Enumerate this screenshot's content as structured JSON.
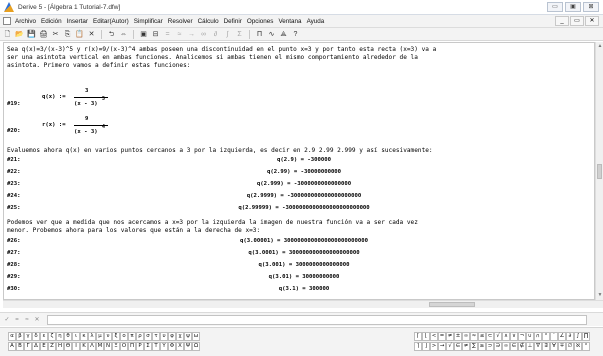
{
  "window": {
    "title": "Derive 5 - [Álgebra 1  Tutorial-7.dfw]",
    "buttons": [
      "▭",
      "▣",
      "⊠"
    ]
  },
  "menubar": {
    "items": [
      "Archivo",
      "Edición",
      "Insertar",
      "Editar(Autor)",
      "Simplificar",
      "Resolver",
      "Cálculo",
      "Definir",
      "Opciones",
      "Ventana",
      "Ayuda"
    ],
    "right_buttons": [
      "_",
      "▭",
      "✕"
    ]
  },
  "toolbar": {
    "icons": [
      "new-icon",
      "open-icon",
      "save-icon",
      "print-icon",
      "cut-icon",
      "copy-icon",
      "paste-icon",
      "delete-icon",
      "undo-icon",
      "renumber-icon",
      "author-icon",
      "solve-icon",
      "simplify-icon",
      "approximate-icon",
      "substitute-icon",
      "limit-icon",
      "derivative-icon",
      "integral-icon",
      "sum-icon",
      "product-icon",
      "plot2d-icon",
      "plot3d-icon",
      "help-icon"
    ],
    "glyphs": [
      "🗋",
      "📂",
      "💾",
      "🖨",
      "✂",
      "⎘",
      "📋",
      "✕",
      "⮌",
      "⇔",
      "▣",
      "⊟",
      "=",
      "≈",
      "→",
      "∞",
      "∂",
      "∫",
      "Σ",
      "Π",
      "∿",
      "⟁",
      "?"
    ]
  },
  "worksheet": {
    "intro": [
      "Sea q(x)=3/(x-3)^5 y r(x)=9/(x-3)^4 ambas poseen una discontinuidad en el punto x=3 y por tanto esta recta (x=3) va a",
      "ser una asintota vertical en ambas funciones. Analicemos si ambas tienen el mismo comportamiento alrededor de la",
      "asintota. Primero vamos a definir estas funciones:"
    ],
    "defs": [
      {
        "label": "#19:",
        "lhs": "q(x) :=",
        "num": "3",
        "den": "(x - 3)",
        "exp": "5"
      },
      {
        "label": "#20:",
        "lhs": "r(x) :=",
        "num": "9",
        "den": "(x - 3)",
        "exp": "4"
      }
    ],
    "text2": "Evaluemos ahora q(x) en varios puntos cercanos a 3 por la izquierda, es decir en 2.9 2.99 2.999 y así sucesivamente:",
    "left_evals": [
      {
        "label": "#21:",
        "expr": "q(2.9) = -300000"
      },
      {
        "label": "#22:",
        "expr": "q(2.99) = -30000000000"
      },
      {
        "label": "#23:",
        "expr": "q(2.999) = -3000000000000000"
      },
      {
        "label": "#24:",
        "expr": "q(2.9999) = -300000000000000000000"
      },
      {
        "label": "#25:",
        "expr": "q(2.99999) = -3000000000000000000000000"
      }
    ],
    "text3": [
      "Podemos ver que a medida que nos acercamos a x=3 por la izquierda la imagen de nuestra función va a ser cada vez",
      "menor. Probemos ahora para los valores que están a la derecha de x=3:"
    ],
    "right_evals": [
      {
        "label": "#26:",
        "expr": "q(3.00001) = 3000000000000000000000000"
      },
      {
        "label": "#27:",
        "expr": "q(3.0001) = 300000000000000000000"
      },
      {
        "label": "#28:",
        "expr": "q(3.001) = 3000000000000000"
      },
      {
        "label": "#29:",
        "expr": "q(3.01) = 30000000000"
      },
      {
        "label": "#30:",
        "expr": "q(3.1) = 300000"
      }
    ]
  },
  "entrybar": {
    "icons": [
      "✓",
      "=",
      "≈",
      "✕"
    ],
    "value": ""
  },
  "palettes": {
    "greek_row1": [
      "α",
      "β",
      "γ",
      "δ",
      "ε",
      "ζ",
      "η",
      "θ",
      "ι",
      "κ",
      "λ",
      "μ",
      "ν",
      "ξ",
      "ο",
      "π",
      "ρ",
      "σ",
      "τ",
      "υ",
      "φ",
      "χ",
      "ψ",
      "ω"
    ],
    "greek_row2": [
      "Α",
      "Β",
      "Γ",
      "Δ",
      "Ε",
      "Ζ",
      "Η",
      "Θ",
      "Ι",
      "Κ",
      "Λ",
      "Μ",
      "Ν",
      "Ξ",
      "Ο",
      "Π",
      "Ρ",
      "Σ",
      "Τ",
      "Υ",
      "Φ",
      "Χ",
      "Ψ",
      "Ω"
    ],
    "symbols_row1": [
      "⌈",
      "⌊",
      "<",
      "=",
      "≠",
      "±",
      "∞",
      "≈",
      "≤",
      "⊂",
      "√",
      "∧",
      "∨",
      "¬",
      "∪",
      "∩",
      "°",
      "′",
      "∠",
      "∂",
      "∫",
      "∏"
    ],
    "symbols_row2": [
      "⌉",
      "⌋",
      ">",
      "→",
      "√",
      "∈",
      "≠",
      "∑",
      "≥",
      "⊃",
      "∋",
      "∞",
      "∈",
      "∉",
      "⊥",
      "∇",
      "∃",
      "∀",
      "∓",
      "∅",
      "ℵ",
      "°"
    ]
  }
}
